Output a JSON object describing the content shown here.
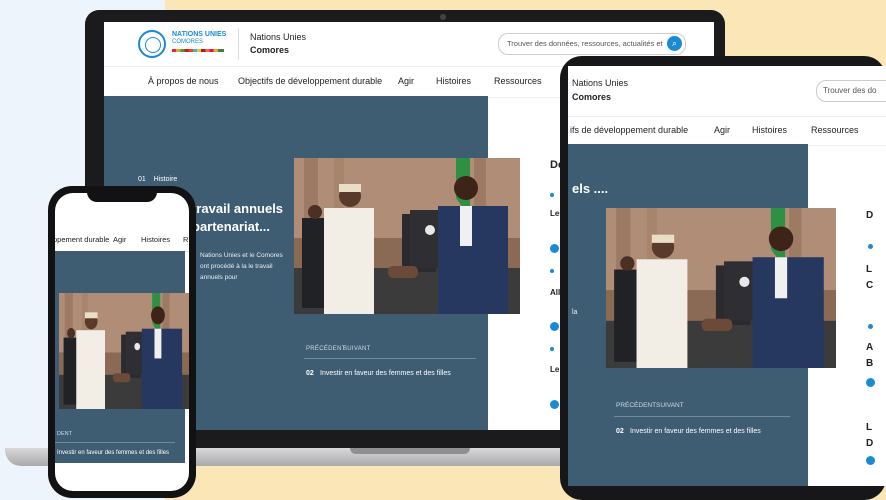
{
  "site": {
    "logo_line1": "NATIONS UNIES",
    "logo_line2": "COMORES",
    "org_line1": "Nations Unies",
    "org_line2": "Comores",
    "search_placeholder": "Trouver des données, ressources, actualités et p",
    "search_icon": "search-icon"
  },
  "nav": {
    "about": "À propos de nous",
    "sdg": "Objectifs de développement durable",
    "act": "Agir",
    "stories": "Histoires",
    "resources": "Ressources"
  },
  "hero": {
    "story_number": "01",
    "story_label": "Histoire",
    "title": "travail annuels partenariat...",
    "body": "Nations Unies et le Comores ont procédé à la le travail annuels pour",
    "prev_label": "PRÉCÉDENT",
    "next_label": "SUIVANT",
    "next_story_number": "02",
    "next_story_title": "Investir en faveur des femmes et des filles"
  },
  "sidebar": {
    "title_fragment": "De",
    "items": [
      {
        "tag": "C",
        "text": "Les Co"
      },
      {
        "tag": "A",
        "text": "All Ba"
      },
      {
        "tag": "C",
        "text": "Le Dé"
      }
    ]
  },
  "tablet": {
    "org_line1": "Nations Unies",
    "org_line2": "Comores",
    "search_placeholder": "Trouver des do",
    "nav_sdg": "ifs de développement durable",
    "nav_act": "Agir",
    "nav_stories": "Histoires",
    "nav_resources": "Ressources",
    "title_fragment": "els ....",
    "body_fragment": "la",
    "prev_label": "PRÉCÉDENT",
    "next_label": "SUIVANT",
    "next_story_number": "02",
    "next_story_title": "Investir en faveur des femmes et des filles",
    "sidebar_letters": [
      "D",
      "L C",
      "A B",
      "L D"
    ]
  },
  "phone": {
    "nav_sdg": "ppement durable",
    "nav_act": "Agir",
    "nav_stories": "Histoires",
    "nav_extra": "R",
    "prev_label": "DENT",
    "next_story_title": "Investir en faveur des femmes et des filles"
  },
  "colors": {
    "un_blue": "#1a8ad4",
    "hero_panel": "#3e5d73",
    "backdrop_yellow": "#fbe6b8"
  }
}
